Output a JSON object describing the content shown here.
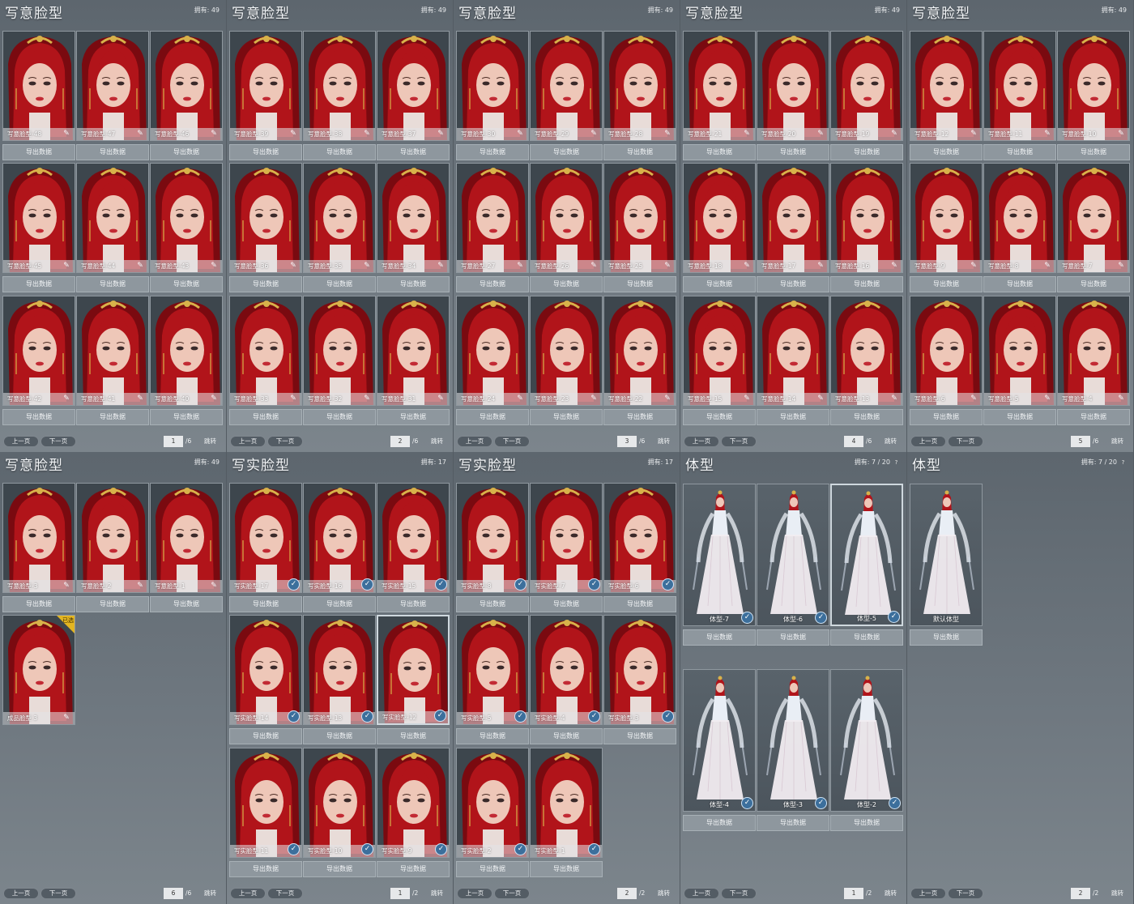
{
  "colors": {
    "hair": "#b1141a",
    "hairDark": "#7a0a10",
    "skin": "#eec7b8",
    "lips": "#c22a34",
    "ornament": "#d8b24a",
    "check": "#3c6f9c",
    "badge": "#e3b522"
  },
  "icons": {
    "edit": "pencil-icon",
    "selected": "check-icon",
    "help": "question-icon"
  },
  "panels": [
    {
      "title": "写意脸型",
      "owned": "拥有: 49",
      "help": "",
      "kind": "face",
      "cards": [
        {
          "name": "写意脸型-48",
          "icon": "edit",
          "export": "导出数据"
        },
        {
          "name": "写意脸型-47",
          "icon": "edit",
          "export": "导出数据"
        },
        {
          "name": "写意脸型-46",
          "icon": "edit",
          "export": "导出数据"
        },
        {
          "name": "写意脸型-45",
          "icon": "edit",
          "export": "导出数据"
        },
        {
          "name": "写意脸型-44",
          "icon": "edit",
          "export": "导出数据"
        },
        {
          "name": "写意脸型-43",
          "icon": "edit",
          "export": "导出数据"
        },
        {
          "name": "写意脸型-42",
          "icon": "edit",
          "export": "导出数据"
        },
        {
          "name": "写意脸型-41",
          "icon": "edit",
          "export": "导出数据"
        },
        {
          "name": "写意脸型-40",
          "icon": "edit",
          "export": "导出数据"
        }
      ],
      "pager": {
        "prev": "上一页",
        "next": "下一页",
        "page": "1",
        "total": "/6",
        "jump": "跳转"
      }
    },
    {
      "title": "写意脸型",
      "owned": "拥有: 49",
      "help": "",
      "kind": "face",
      "cards": [
        {
          "name": "写意脸型-39",
          "icon": "edit",
          "export": "导出数据"
        },
        {
          "name": "写意脸型-38",
          "icon": "edit",
          "export": "导出数据"
        },
        {
          "name": "写意脸型-37",
          "icon": "edit",
          "export": "导出数据"
        },
        {
          "name": "写意脸型-36",
          "icon": "edit",
          "export": "导出数据"
        },
        {
          "name": "写意脸型-35",
          "icon": "edit",
          "export": "导出数据"
        },
        {
          "name": "写意脸型-34",
          "icon": "edit",
          "export": "导出数据"
        },
        {
          "name": "写意脸型-33",
          "icon": "edit",
          "export": "导出数据"
        },
        {
          "name": "写意脸型-32",
          "icon": "edit",
          "export": "导出数据"
        },
        {
          "name": "写意脸型-31",
          "icon": "edit",
          "export": "导出数据"
        }
      ],
      "pager": {
        "prev": "上一页",
        "next": "下一页",
        "page": "2",
        "total": "/6",
        "jump": "跳转"
      }
    },
    {
      "title": "写意脸型",
      "owned": "拥有: 49",
      "help": "",
      "kind": "face",
      "cards": [
        {
          "name": "写意脸型-30",
          "icon": "edit",
          "export": "导出数据"
        },
        {
          "name": "写意脸型-29",
          "icon": "edit",
          "export": "导出数据"
        },
        {
          "name": "写意脸型-28",
          "icon": "edit",
          "export": "导出数据"
        },
        {
          "name": "写意脸型-27",
          "icon": "edit",
          "export": "导出数据"
        },
        {
          "name": "写意脸型-26",
          "icon": "edit",
          "export": "导出数据"
        },
        {
          "name": "写意脸型-25",
          "icon": "edit",
          "export": "导出数据"
        },
        {
          "name": "写意脸型-24",
          "icon": "edit",
          "export": "导出数据"
        },
        {
          "name": "写意脸型-23",
          "icon": "edit",
          "export": "导出数据"
        },
        {
          "name": "写意脸型-22",
          "icon": "edit",
          "export": "导出数据"
        }
      ],
      "pager": {
        "prev": "上一页",
        "next": "下一页",
        "page": "3",
        "total": "/6",
        "jump": "跳转"
      }
    },
    {
      "title": "写意脸型",
      "owned": "拥有: 49",
      "help": "",
      "kind": "face",
      "cards": [
        {
          "name": "写意脸型-21",
          "icon": "edit",
          "export": "导出数据"
        },
        {
          "name": "写意脸型-20",
          "icon": "edit",
          "export": "导出数据"
        },
        {
          "name": "写意脸型-19",
          "icon": "edit",
          "export": "导出数据"
        },
        {
          "name": "写意脸型-18",
          "icon": "edit",
          "export": "导出数据"
        },
        {
          "name": "写意脸型-17",
          "icon": "edit",
          "export": "导出数据"
        },
        {
          "name": "写意脸型-16",
          "icon": "edit",
          "export": "导出数据"
        },
        {
          "name": "写意脸型-15",
          "icon": "edit",
          "export": "导出数据"
        },
        {
          "name": "写意脸型-14",
          "icon": "edit",
          "export": "导出数据"
        },
        {
          "name": "写意脸型-13",
          "icon": "edit",
          "export": "导出数据"
        }
      ],
      "pager": {
        "prev": "上一页",
        "next": "下一页",
        "page": "4",
        "total": "/6",
        "jump": "跳转"
      }
    },
    {
      "title": "写意脸型",
      "owned": "拥有: 49",
      "help": "",
      "kind": "face",
      "cards": [
        {
          "name": "写意脸型-12",
          "icon": "edit",
          "export": "导出数据"
        },
        {
          "name": "写意脸型-11",
          "icon": "edit",
          "export": "导出数据"
        },
        {
          "name": "写意脸型-10",
          "icon": "edit",
          "export": "导出数据"
        },
        {
          "name": "写意脸型-9",
          "icon": "edit",
          "export": "导出数据"
        },
        {
          "name": "写意脸型-8",
          "icon": "edit",
          "export": "导出数据"
        },
        {
          "name": "写意脸型-7",
          "icon": "edit",
          "export": "导出数据"
        },
        {
          "name": "写意脸型-6",
          "icon": "edit",
          "export": "导出数据"
        },
        {
          "name": "写意脸型-5",
          "icon": "edit",
          "export": "导出数据"
        },
        {
          "name": "写意脸型-4",
          "icon": "edit",
          "export": "导出数据"
        }
      ],
      "pager": {
        "prev": "上一页",
        "next": "下一页",
        "page": "5",
        "total": "/6",
        "jump": "跳转"
      }
    },
    {
      "title": "写意脸型",
      "owned": "拥有: 49",
      "help": "",
      "kind": "face",
      "cards": [
        {
          "name": "写意脸型-3",
          "icon": "edit",
          "export": "导出数据"
        },
        {
          "name": "写意脸型-2",
          "icon": "edit",
          "export": "导出数据"
        },
        {
          "name": "写意脸型-1",
          "icon": "edit",
          "export": "导出数据"
        },
        {
          "name": "成品脸型 3",
          "icon": "edit",
          "badge": "已选",
          "export": ""
        }
      ],
      "pager": {
        "prev": "上一页",
        "next": "下一页",
        "page": "6",
        "total": "/6",
        "jump": "跳转"
      }
    },
    {
      "title": "写实脸型",
      "owned": "拥有: 17",
      "help": "",
      "kind": "face",
      "cards": [
        {
          "name": "写实脸型-17",
          "icon": "check",
          "export": "导出数据"
        },
        {
          "name": "写实脸型-16",
          "icon": "check",
          "export": "导出数据"
        },
        {
          "name": "写实脸型-15",
          "icon": "check",
          "export": "导出数据"
        },
        {
          "name": "写实脸型-14",
          "icon": "check",
          "export": "导出数据"
        },
        {
          "name": "写实脸型-13",
          "icon": "check",
          "export": "导出数据"
        },
        {
          "name": "写实脸型-12",
          "icon": "check",
          "export": "导出数据",
          "selected": true
        },
        {
          "name": "写实脸型-11",
          "icon": "check",
          "export": "导出数据"
        },
        {
          "name": "写实脸型-10",
          "icon": "check",
          "export": "导出数据"
        },
        {
          "name": "写实脸型-9",
          "icon": "check",
          "export": "导出数据"
        }
      ],
      "pager": {
        "prev": "上一页",
        "next": "下一页",
        "page": "1",
        "total": "/2",
        "jump": "跳转"
      }
    },
    {
      "title": "写实脸型",
      "owned": "拥有: 17",
      "help": "",
      "kind": "face",
      "cards": [
        {
          "name": "写实脸型-8",
          "icon": "check",
          "export": "导出数据"
        },
        {
          "name": "写实脸型-7",
          "icon": "check",
          "export": "导出数据"
        },
        {
          "name": "写实脸型-6",
          "icon": "check",
          "export": "导出数据"
        },
        {
          "name": "写实脸型-5",
          "icon": "check",
          "export": "导出数据"
        },
        {
          "name": "写实脸型-4",
          "icon": "check",
          "export": "导出数据"
        },
        {
          "name": "写实脸型-3",
          "icon": "check",
          "export": "导出数据"
        },
        {
          "name": "写实脸型-2",
          "icon": "check",
          "export": "导出数据"
        },
        {
          "name": "写实脸型-1",
          "icon": "check",
          "export": "导出数据"
        }
      ],
      "pager": {
        "prev": "上一页",
        "next": "下一页",
        "page": "2",
        "total": "/2",
        "jump": "跳转"
      }
    },
    {
      "title": "体型",
      "owned": "拥有: 7 / 20",
      "help": "?",
      "kind": "body",
      "cards": [
        {
          "name": "体型-7",
          "icon": "check",
          "export": "导出数据"
        },
        {
          "name": "体型-6",
          "icon": "check",
          "export": "导出数据"
        },
        {
          "name": "体型-5",
          "icon": "check",
          "export": "导出数据",
          "selected": true
        },
        {
          "name": "体型-4",
          "icon": "check",
          "export": "导出数据"
        },
        {
          "name": "体型-3",
          "icon": "check",
          "export": "导出数据"
        },
        {
          "name": "体型-2",
          "icon": "check",
          "export": "导出数据"
        }
      ],
      "pager": {
        "prev": "上一页",
        "next": "下一页",
        "page": "1",
        "total": "/2",
        "jump": "跳转"
      }
    },
    {
      "title": "体型",
      "owned": "拥有: 7 / 20",
      "help": "?",
      "kind": "body",
      "cards": [
        {
          "name": "默认体型",
          "icon": "none",
          "export": "导出数据"
        }
      ],
      "pager": {
        "prev": "上一页",
        "next": "下一页",
        "page": "2",
        "total": "/2",
        "jump": "跳转"
      }
    }
  ]
}
